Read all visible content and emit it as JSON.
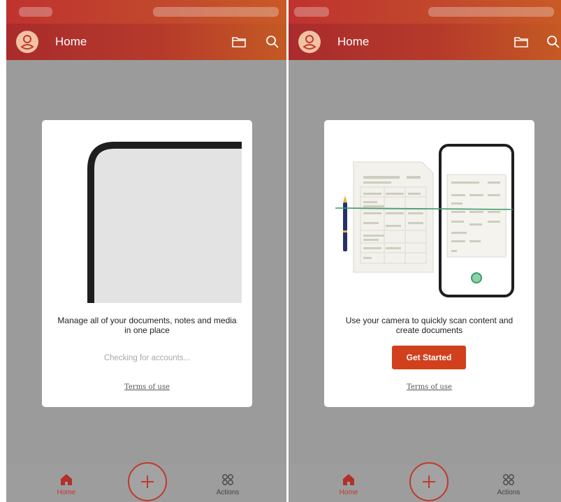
{
  "left": {
    "header": {
      "title": "Home"
    },
    "card": {
      "description": "Manage all of your documents, notes and media in one place",
      "status": "Checking for accounts...",
      "terms_link": "Terms of use"
    },
    "bottom_nav": {
      "home": "Home",
      "actions": "Actions"
    }
  },
  "right": {
    "header": {
      "title": "Home"
    },
    "card": {
      "description": "Use your camera to quickly scan content and create documents",
      "button": "Get Started",
      "terms_link": "Terms of use"
    },
    "bottom_nav": {
      "home": "Home",
      "actions": "Actions"
    }
  },
  "colors": {
    "accent": "#d1401c",
    "header_start": "#a92b2d",
    "header_end": "#c45a23",
    "scan_line": "#3c9a6a"
  },
  "icons": [
    "person-icon",
    "folder-icon",
    "search-icon",
    "home-icon",
    "plus-icon",
    "actions-grid-icon"
  ]
}
